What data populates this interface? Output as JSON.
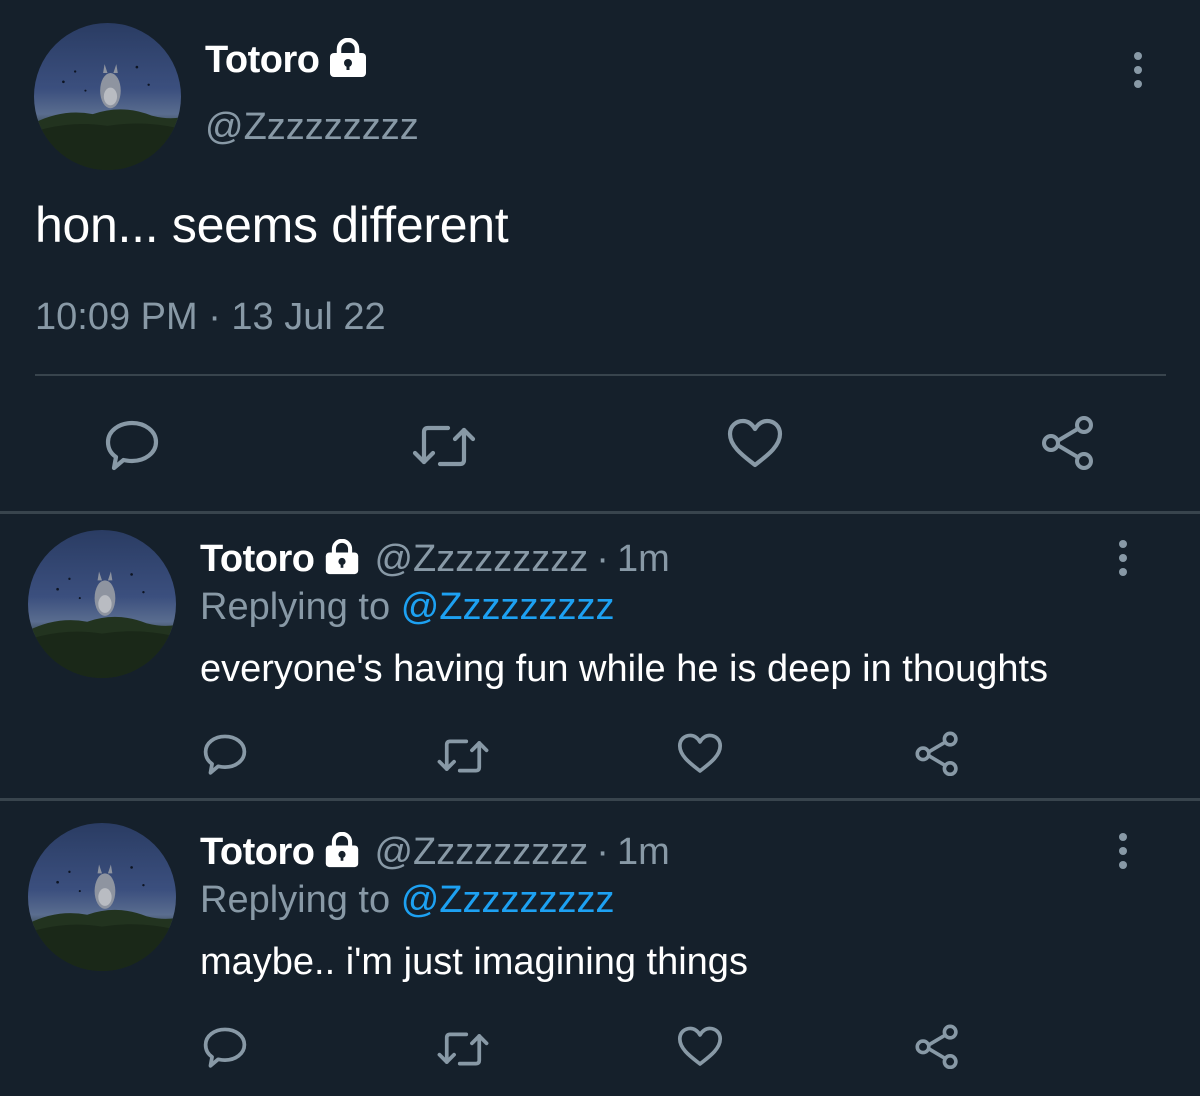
{
  "main_tweet": {
    "name": "Totoro",
    "handle": "@Zzzzzzzzz",
    "text": "hon... seems different",
    "timestamp": "10:09 PM · 13 Jul 22",
    "icons": [
      "lock-icon",
      "more-icon",
      "reply-icon",
      "retweet-icon",
      "like-icon",
      "share-icon"
    ]
  },
  "replies": [
    {
      "name": "Totoro",
      "handle": "@Zzzzzzzzz",
      "separator": "·",
      "time": "1m",
      "replying_prefix": "Replying to",
      "replying_to": "@Zzzzzzzzz",
      "text": "everyone's having fun while he is deep in thoughts"
    },
    {
      "name": "Totoro",
      "handle": "@Zzzzzzzzz",
      "separator": "·",
      "time": "1m",
      "replying_prefix": "Replying to",
      "replying_to": "@Zzzzzzzzz",
      "text": "maybe.. i'm just imagining things"
    }
  ],
  "colors": {
    "background": "#15202b",
    "text": "#ffffff",
    "secondary": "#8899a6",
    "link": "#1da1f2",
    "divider": "#38444d"
  }
}
